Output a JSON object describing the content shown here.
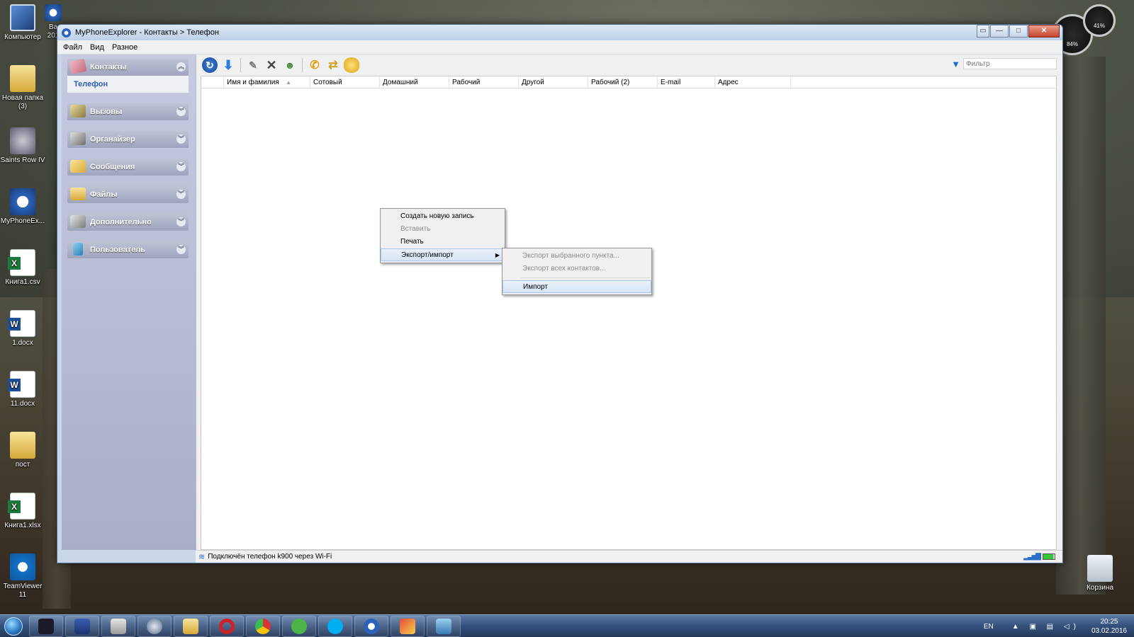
{
  "desktop": {
    "icons": [
      {
        "label": "Компьютер"
      },
      {
        "label": "Новая папка (3)"
      },
      {
        "label": "Saints Row IV"
      },
      {
        "label": "MyPhoneEx..."
      },
      {
        "label": "Книга1.csv"
      },
      {
        "label": "1.docx"
      },
      {
        "label": "11.docx"
      },
      {
        "label": "пост"
      },
      {
        "label": "Книга1.xlsx"
      },
      {
        "label": "TeamViewer 11"
      },
      {
        "label": "Корзина"
      }
    ],
    "partial_icon_label": "Ва 201"
  },
  "gadget": {
    "gauge_left": "84%",
    "gauge_right": "41%"
  },
  "window": {
    "title": "MyPhoneExplorer -  Контакты > Телефон",
    "controls": {
      "restore": "▭",
      "minimize": "—",
      "maximize": "□",
      "close": "✕"
    }
  },
  "menubar": {
    "items": [
      {
        "label": "Файл"
      },
      {
        "label": "Вид"
      },
      {
        "label": "Разное"
      }
    ]
  },
  "sidebar": {
    "groups": [
      {
        "label": "Контакты",
        "chevron": "︽",
        "sub": "Телефон"
      },
      {
        "label": "Вызовы",
        "chevron": "︾"
      },
      {
        "label": "Органайзер",
        "chevron": "︾"
      },
      {
        "label": "Сообщения",
        "chevron": "︾"
      },
      {
        "label": "Файлы",
        "chevron": "︾"
      },
      {
        "label": "Дополнительно",
        "chevron": "︾"
      },
      {
        "label": "Пользователь",
        "chevron": "︾"
      }
    ]
  },
  "toolbar": {
    "icons": [
      "refresh-icon",
      "download-icon",
      "edit-icon",
      "delete-icon",
      "add-contact-icon",
      "call-icon",
      "sync-icon",
      "sms-icon"
    ],
    "filter_placeholder": "Фильтр"
  },
  "grid": {
    "columns": [
      {
        "label": "Имя и фамилия",
        "sort": "▲"
      },
      {
        "label": "Сотовый"
      },
      {
        "label": "Домашний"
      },
      {
        "label": "Рабочий"
      },
      {
        "label": "Другой"
      },
      {
        "label": "Рабочий (2)"
      },
      {
        "label": "E-mail"
      },
      {
        "label": "Адрес"
      }
    ]
  },
  "context_menu": {
    "items": [
      {
        "label": "Создать новую запись",
        "disabled": false
      },
      {
        "label": "Вставить",
        "disabled": true
      },
      {
        "label": "Печать",
        "disabled": false
      },
      {
        "label": "Экспорт/импорт",
        "disabled": false,
        "submenu_arrow": "▶"
      }
    ],
    "submenu": [
      {
        "label": "Экспорт выбранного пункта...",
        "disabled": true
      },
      {
        "label": "Экспорт всех контактов...",
        "disabled": true
      },
      {
        "label": "Импорт",
        "disabled": false
      }
    ]
  },
  "statusbar": {
    "text": "Подключён телефон k900 через Wi-Fi"
  },
  "taskbar": {
    "apps": [
      "network-app-icon",
      "save-app-icon",
      "calculator-app-icon",
      "browser-app-icon",
      "explorer-app-icon",
      "opera-icon",
      "chrome-icon",
      "utorrent-icon",
      "skype-icon",
      "myphoneexplorer-icon",
      "paint-app-icon",
      "photos-app-icon"
    ],
    "lang": "EN",
    "tray": "▲ ▣ ▤ ◁)",
    "time": "20:25",
    "date": "03.02.2016"
  }
}
